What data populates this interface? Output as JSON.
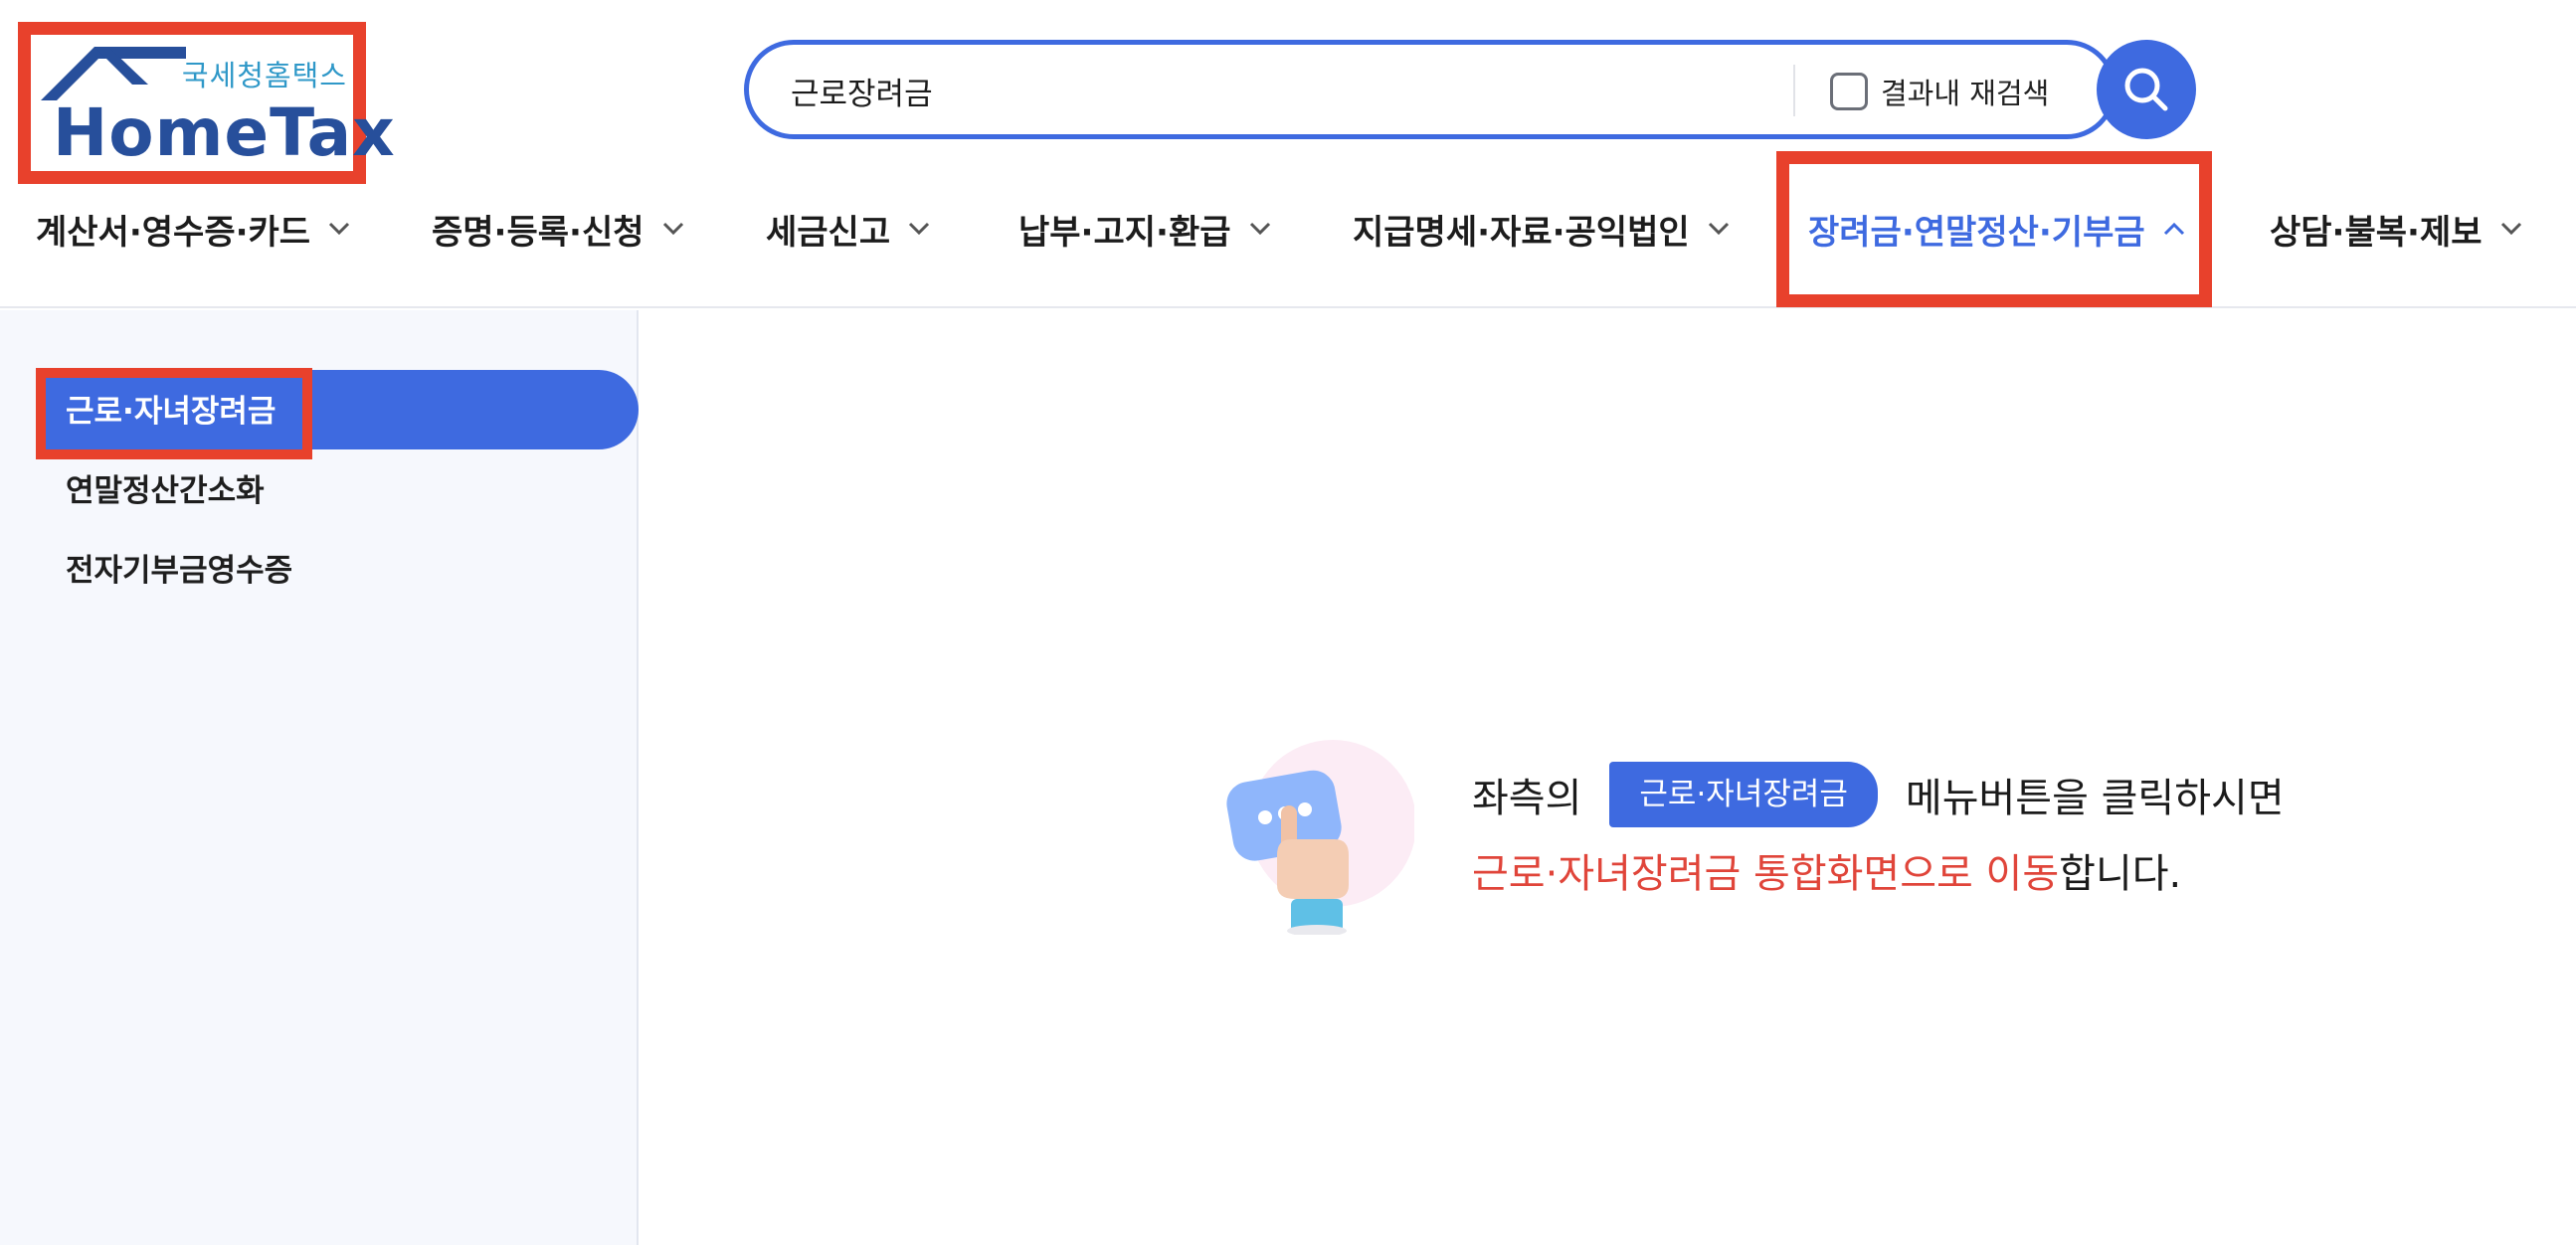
{
  "header": {
    "logo": {
      "subtitle": "국세청홈택스",
      "name": "HomeTax"
    },
    "search": {
      "value": "근로장려금",
      "recheck_label": "결과내 재검색",
      "recheck_checked": false
    }
  },
  "nav": {
    "items": [
      {
        "label": "계산서·영수증·카드",
        "expanded": false
      },
      {
        "label": "증명·등록·신청",
        "expanded": false
      },
      {
        "label": "세금신고",
        "expanded": false
      },
      {
        "label": "납부·고지·환급",
        "expanded": false
      },
      {
        "label": "지급명세·자료·공익법인",
        "expanded": false
      },
      {
        "label": "장려금·연말정산·기부금",
        "expanded": true
      },
      {
        "label": "상담·불복·제보",
        "expanded": false
      }
    ]
  },
  "sidebar": {
    "items": [
      {
        "label": "근로·자녀장려금",
        "active": true
      },
      {
        "label": "연말정산간소화",
        "active": false
      },
      {
        "label": "전자기부금영수증",
        "active": false
      }
    ]
  },
  "content": {
    "prefix": "좌측의",
    "button_label": "근로·자녀장려금",
    "suffix": "메뉴버튼을 클릭하시면",
    "highlight": "근로·자녀장려금 통합화면으로 이동",
    "ending": "합니다."
  },
  "colors": {
    "accent": "#3e6ae0",
    "annotation_red": "#e8412c",
    "message_red": "#e0453a",
    "sidebar_bg": "#f6f8fd"
  },
  "icons": [
    "search-icon",
    "chevron-down-icon",
    "chevron-up-icon",
    "home-roof-icon",
    "tap-hand-icon"
  ]
}
